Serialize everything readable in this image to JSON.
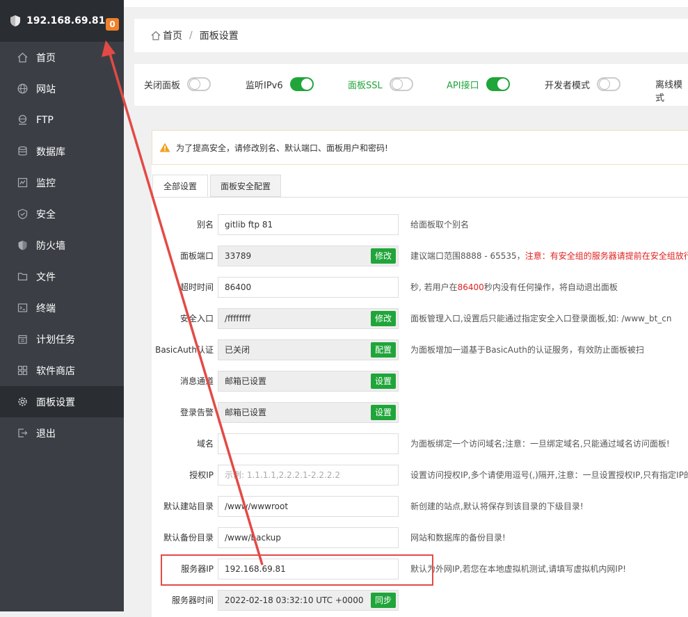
{
  "sidebar": {
    "server_ip": "192.168.69.81",
    "badge_count": "0",
    "items": [
      {
        "label": "首页",
        "icon": "home-icon"
      },
      {
        "label": "网站",
        "icon": "globe-icon"
      },
      {
        "label": "FTP",
        "icon": "ftp-icon"
      },
      {
        "label": "数据库",
        "icon": "database-icon"
      },
      {
        "label": "监控",
        "icon": "monitor-icon"
      },
      {
        "label": "安全",
        "icon": "shield-check-icon"
      },
      {
        "label": "防火墙",
        "icon": "firewall-icon"
      },
      {
        "label": "文件",
        "icon": "folder-icon"
      },
      {
        "label": "终端",
        "icon": "terminal-icon"
      },
      {
        "label": "计划任务",
        "icon": "calendar-icon"
      },
      {
        "label": "软件商店",
        "icon": "apps-icon"
      },
      {
        "label": "面板设置",
        "icon": "gear-icon",
        "active": true
      },
      {
        "label": "退出",
        "icon": "logout-icon"
      }
    ]
  },
  "breadcrumb": {
    "home": "首页",
    "separator": "/",
    "current": "面板设置"
  },
  "toggles": [
    {
      "label": "关闭面板",
      "on": false
    },
    {
      "label": "监听IPv6",
      "on": true
    },
    {
      "label": "面板SSL",
      "on": false,
      "color": "#20a53a"
    },
    {
      "label": "API接口",
      "on": true,
      "color": "#20a53a"
    },
    {
      "label": "开发者模式",
      "on": false
    },
    {
      "label": "离线模式"
    }
  ],
  "warning": "为了提高安全，请修改别名、默认端口、面板用户和密码!",
  "tabs": [
    "全部设置",
    "面板安全配置"
  ],
  "fields": [
    {
      "label": "别名",
      "value": "gitlib ftp 81",
      "hint": "给面板取个别名"
    },
    {
      "label": "面板端口",
      "value": "33789",
      "button": "修改",
      "hint_a": "建议端口范围8888 - 65535，",
      "hint_red": "注意：有安全组的服务器请提前在安全组放行"
    },
    {
      "label": "超时时间",
      "value": "86400",
      "hint_a": "秒, 若用户在",
      "hint_red": "86400",
      "hint_b": "秒内没有任何操作，将自动退出面板"
    },
    {
      "label": "安全入口",
      "value": "/ffffffff",
      "button": "修改",
      "hint": "面板管理入口,设置后只能通过指定安全入口登录面板,如: /www_bt_cn"
    },
    {
      "label": "BasicAuth认证",
      "value": "已关闭",
      "button": "配置",
      "hint": "为面板增加一道基于BasicAuth的认证服务，有效防止面板被扫"
    },
    {
      "label": "消息通道",
      "value": "邮箱已设置",
      "button": "设置"
    },
    {
      "label": "登录告警",
      "value": "邮箱已设置",
      "button": "设置"
    },
    {
      "label": "域名",
      "value": "",
      "hint": "为面板绑定一个访问域名;注意：一旦绑定域名,只能通过域名访问面板!"
    },
    {
      "label": "授权IP",
      "placeholder": "示例: 1.1.1.1,2.2.2.1-2.2.2.2",
      "hint": "设置访问授权IP,多个请使用逗号(,)隔开,注意：一旦设置授权IP,只有指定IP的"
    },
    {
      "label": "默认建站目录",
      "value": "/www/wwwroot",
      "hint": "新创建的站点,默认将保存到该目录的下级目录!"
    },
    {
      "label": "默认备份目录",
      "value": "/www/backup",
      "hint": "网站和数据库的备份目录!"
    },
    {
      "label": "服务器IP",
      "value": "192.168.69.81",
      "hint": "默认为外网IP,若您在本地虚拟机测试,请填写虚拟机内网IP!"
    },
    {
      "label": "服务器时间",
      "value": "2022-02-18 03:32:10 UTC +0000",
      "button": "同步"
    }
  ],
  "colors": {
    "accent": "#20a53a",
    "annotation": "#e34a45",
    "badge": "#f0802a",
    "sidebar": "#3b3f45"
  }
}
